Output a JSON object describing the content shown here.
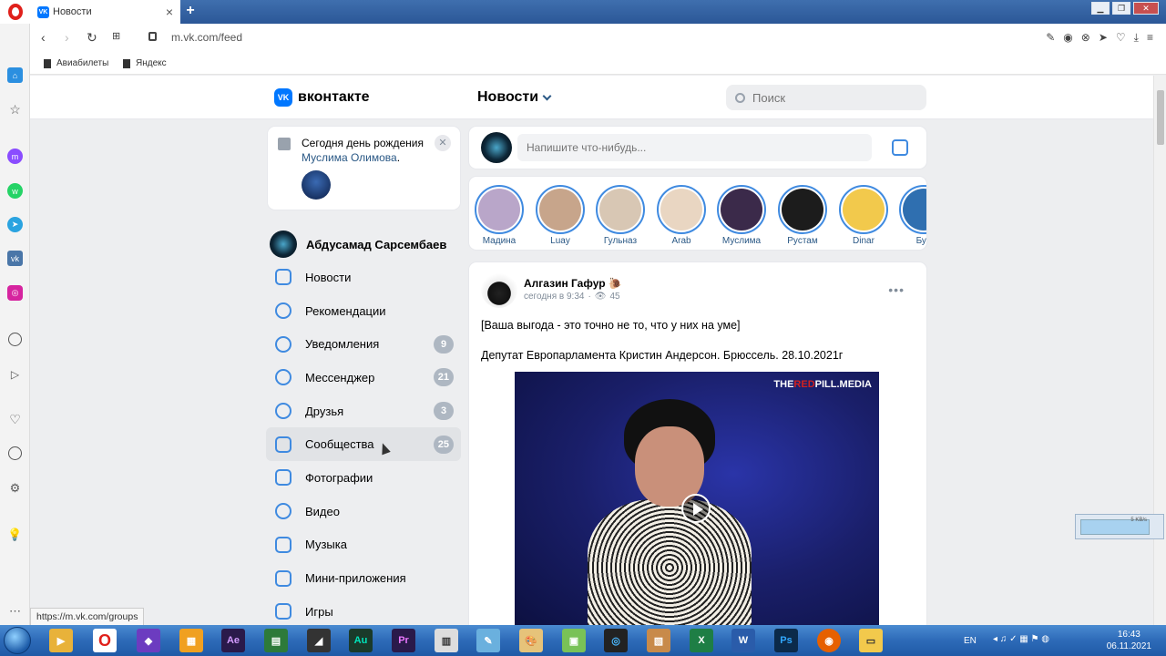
{
  "browser": {
    "tab_title": "Новости",
    "tab_favicon": "VK",
    "url": "m.vk.com/feed",
    "bookmarks": [
      "Авиабилеты",
      "Яндекс"
    ],
    "hover_link": "https://m.vk.com/groups"
  },
  "vk": {
    "logo_text": "вконтакте",
    "logo_mark": "VK",
    "section_title": "Новости",
    "search_placeholder": "Поиск",
    "brand_color": "#0077ff",
    "link_color": "#2a5885"
  },
  "birthday": {
    "text": "Сегодня день рождения",
    "name": "Муслима Олимова",
    "close": "✕"
  },
  "profile": {
    "name": "Абдусамад Сарсембаев"
  },
  "menu": [
    {
      "label": "Новости",
      "icon": "news-icon",
      "badge": null
    },
    {
      "label": "Рекомендации",
      "icon": "compass-icon",
      "badge": null
    },
    {
      "label": "Уведомления",
      "icon": "bell-icon",
      "badge": "9"
    },
    {
      "label": "Мессенджер",
      "icon": "chat-icon",
      "badge": "21"
    },
    {
      "label": "Друзья",
      "icon": "user-icon",
      "badge": "3"
    },
    {
      "label": "Сообщества",
      "icon": "users-icon",
      "badge": "25"
    },
    {
      "label": "Фотографии",
      "icon": "camera-icon",
      "badge": null
    },
    {
      "label": "Видео",
      "icon": "play-icon",
      "badge": null
    },
    {
      "label": "Музыка",
      "icon": "music-icon",
      "badge": null
    },
    {
      "label": "Мини-приложения",
      "icon": "apps-icon",
      "badge": null
    },
    {
      "label": "Игры",
      "icon": "gamepad-icon",
      "badge": null
    }
  ],
  "composer": {
    "placeholder": "Напишите что-нибудь..."
  },
  "stories": [
    {
      "name": "Мадина",
      "color": "#b9a6c9"
    },
    {
      "name": "Luay",
      "color": "#c7a58b"
    },
    {
      "name": "Гульназ",
      "color": "#d8c7b4"
    },
    {
      "name": "Arab",
      "color": "#e9d6c2"
    },
    {
      "name": "Муслима",
      "color": "#3b2a4a"
    },
    {
      "name": "Рустам",
      "color": "#1c1c1c"
    },
    {
      "name": "Dinar",
      "color": "#f2c94c"
    },
    {
      "name": "Бур",
      "color": "#2f6fb0"
    }
  ],
  "post": {
    "author": "Алгазин Гафур",
    "time": "сегодня в 9:34",
    "views": "45",
    "text_line1": "[Ваша выгода - это точно не то, что у них на уме]",
    "text_line2": "Депутат Европарламента Кристин Андерсон. Брюссель. 28.10.2021г",
    "video_watermark_a": "THE",
    "video_watermark_b": "RED",
    "video_watermark_c": "PILL.MEDIA"
  },
  "taskbar": {
    "lang": "EN",
    "time": "16:43",
    "date": "06.11.2021"
  }
}
